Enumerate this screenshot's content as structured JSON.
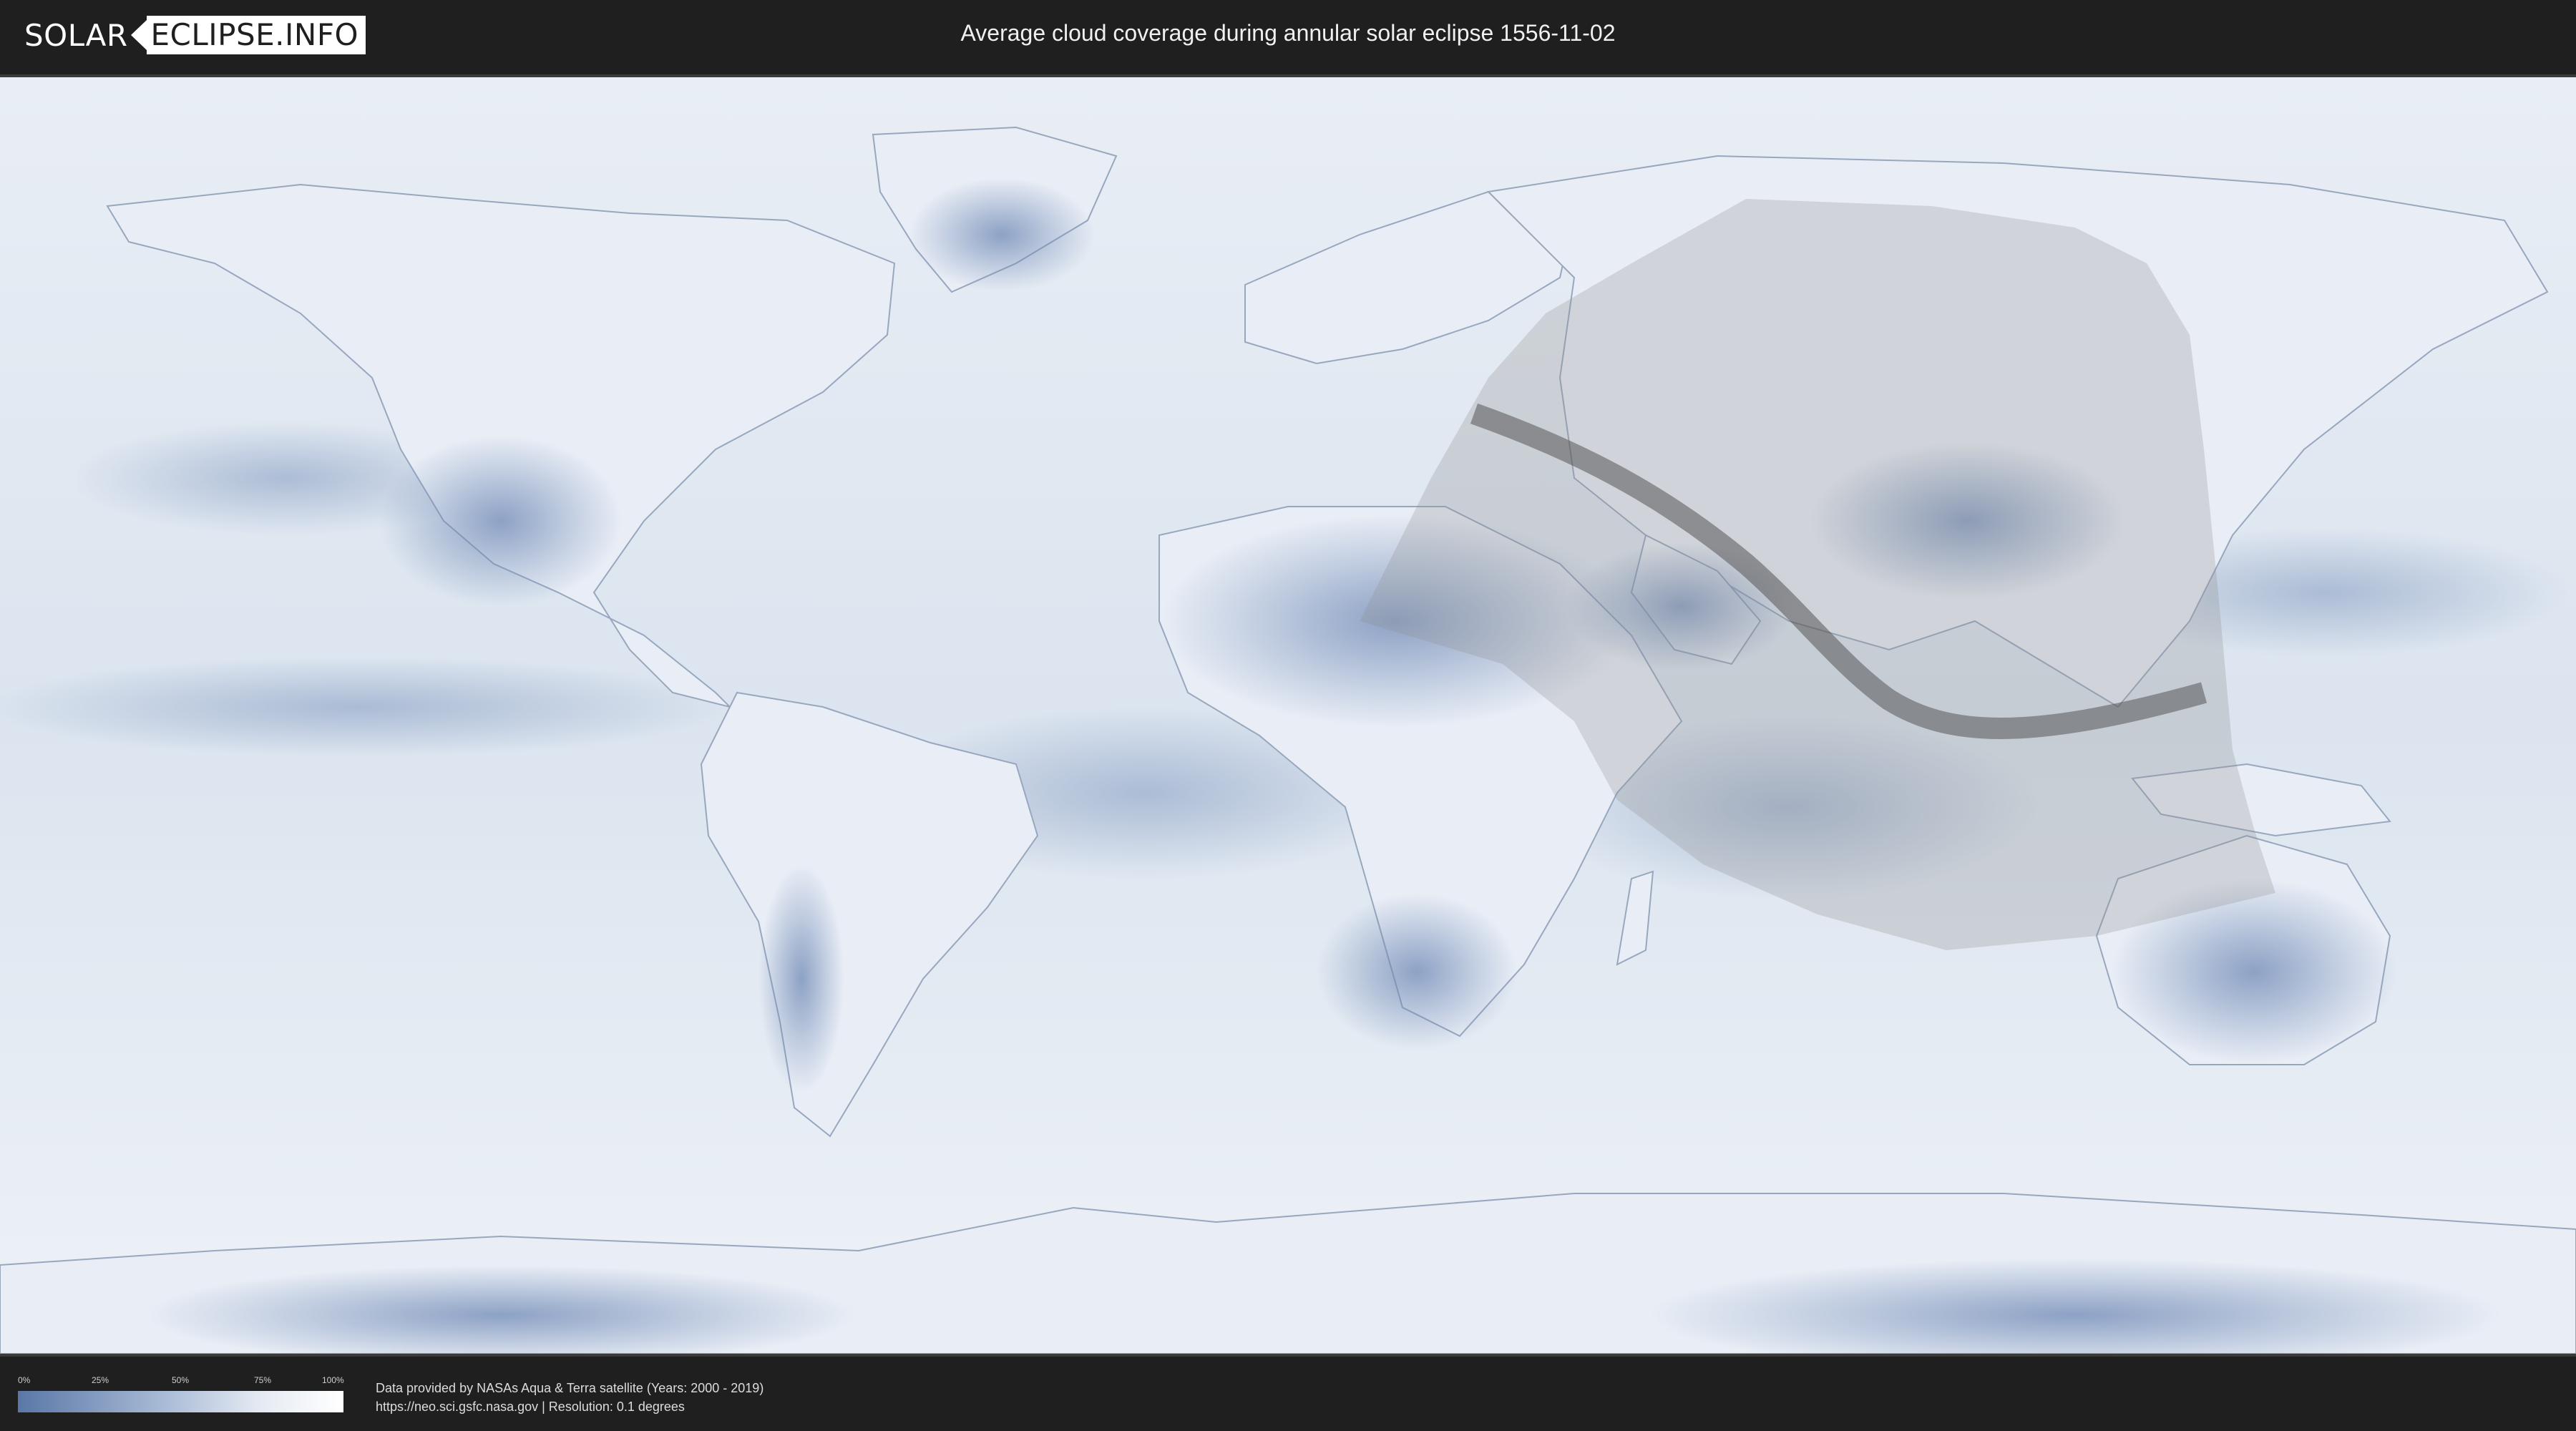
{
  "brand": {
    "part1": "SOLAR",
    "part2": "ECLIPSE.INFO"
  },
  "title": "Average cloud coverage during annular solar eclipse 1556-11-02",
  "legend": {
    "ticks": [
      "0%",
      "25%",
      "50%",
      "75%",
      "100%"
    ],
    "colors": {
      "low": "#5a77a7",
      "high": "#ffffff"
    }
  },
  "credits": {
    "line1": "Data provided by NASAs Aqua & Terra satellite (Years: 2000 - 2019)",
    "line2": "https://neo.sci.gsfc.nasa.gov | Resolution: 0.1 degrees"
  },
  "map": {
    "layers": [
      "cloud-coverage",
      "continents",
      "eclipse-visibility-zone",
      "annularity-path"
    ],
    "colors": {
      "ocean": "#e4ebf4",
      "cloud_dark": "#6e88b4",
      "land_outline": "#9aa9bf",
      "eclipse_zone": "#9a9a9a",
      "annular_path": "#5a5a5a"
    }
  }
}
